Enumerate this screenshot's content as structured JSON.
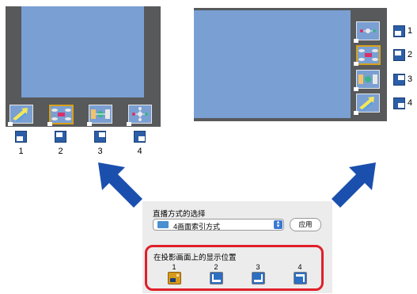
{
  "left_monitor": {
    "labels": [
      "1",
      "2",
      "3",
      "4"
    ],
    "selected_thumb": 2
  },
  "right_monitor": {
    "labels": [
      "1",
      "2",
      "3",
      "4"
    ],
    "selected_thumb": 2
  },
  "panel": {
    "title": "直播方式的选择",
    "dropdown_value": "4画面索引方式",
    "apply_label": "应用",
    "position_title": "在投影画面上的显示位置",
    "position_numbers": [
      "1",
      "2",
      "3",
      "4"
    ],
    "selected_position": 1
  },
  "colors": {
    "accent_blue": "#2c5ea8",
    "arrow_blue": "#1a4fae",
    "highlight_red": "#e0202a",
    "selected_gold": "#d89a1c",
    "screen_blue": "#7a9fd3"
  }
}
